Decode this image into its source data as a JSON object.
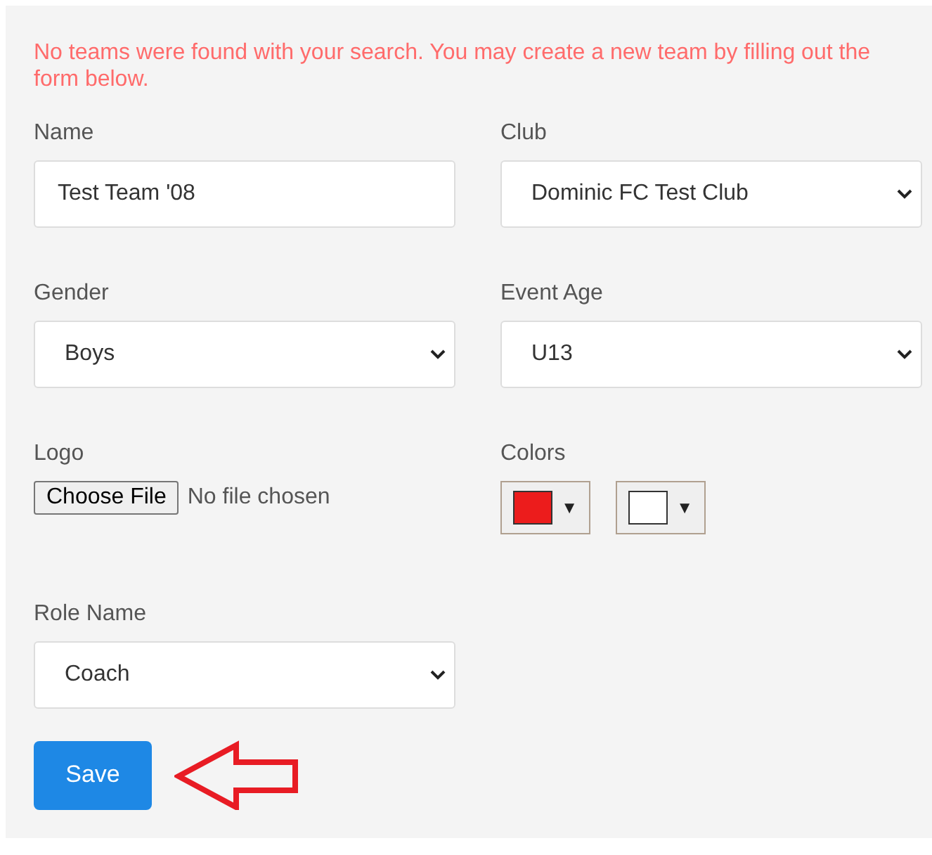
{
  "message": "No teams were found with your search. You may create a new team by filling out the form below.",
  "fields": [
    {
      "kind": "text",
      "label": "Name",
      "value": "Test Team '08"
    },
    {
      "kind": "select",
      "label": "Club",
      "value": "Dominic FC Test Club"
    },
    {
      "kind": "select",
      "label": "Gender",
      "value": "Boys"
    },
    {
      "kind": "select",
      "label": "Event Age",
      "value": "U13"
    },
    {
      "kind": "file",
      "label": "Logo",
      "button": "Choose File",
      "status": "No file chosen"
    },
    {
      "kind": "colors",
      "label": "Colors",
      "pickers": [
        {
          "color": "#ec1c1c",
          "caret": "▼"
        },
        {
          "color": "#ffffff",
          "caret": "▼"
        }
      ]
    },
    {
      "kind": "select",
      "label": "Role Name",
      "value": "Coach"
    }
  ],
  "save_button": "Save"
}
